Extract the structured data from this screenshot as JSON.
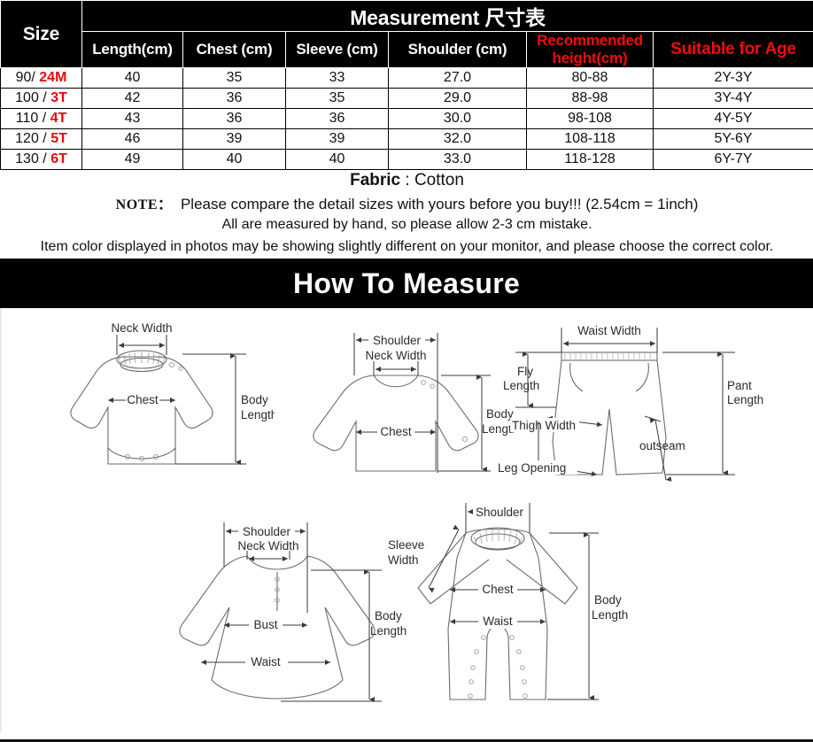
{
  "table": {
    "title": "Measurement 尺寸表",
    "size_header": "Size",
    "columns": [
      "Length(cm)",
      "Chest (cm)",
      "Sleeve (cm)",
      "Shoulder (cm)",
      "Recommended height(cm)",
      "Suitable for Age"
    ],
    "columns_split": {
      "recommended_l1": "Recommended",
      "recommended_l2": "height(cm)"
    },
    "rows": [
      {
        "size_num": "90/",
        "size_tag": "24M",
        "length": "40",
        "chest": "35",
        "sleeve": "33",
        "shoulder": "27.0",
        "height": "80-88",
        "age": "2Y-3Y"
      },
      {
        "size_num": "100 /",
        "size_tag": "3T",
        "length": "42",
        "chest": "36",
        "sleeve": "35",
        "shoulder": "29.0",
        "height": "88-98",
        "age": "3Y-4Y"
      },
      {
        "size_num": "110 /",
        "size_tag": "4T",
        "length": "43",
        "chest": "36",
        "sleeve": "36",
        "shoulder": "30.0",
        "height": "98-108",
        "age": "4Y-5Y"
      },
      {
        "size_num": "120 /",
        "size_tag": "5T",
        "length": "46",
        "chest": "39",
        "sleeve": "39",
        "shoulder": "32.0",
        "height": "108-118",
        "age": "5Y-6Y"
      },
      {
        "size_num": "130 /",
        "size_tag": "6T",
        "length": "49",
        "chest": "40",
        "sleeve": "40",
        "shoulder": "33.0",
        "height": "118-128",
        "age": "6Y-7Y"
      }
    ],
    "fabric_label": "Fabric",
    "fabric_value": " : Cotton",
    "note_label": "NOTE：",
    "note_text": "Please compare the detail sizes with yours before you buy!!! (2.54cm = 1inch)",
    "measure_note": "All are measured by hand, so please allow 2-3 cm mistake.",
    "color_note": "Item color displayed in photos may be showing slightly different on your monitor, and please choose the correct color."
  },
  "banner": {
    "title": "How To Measure"
  },
  "diagrams": {
    "bodysuit": {
      "neck_width": "Neck Width",
      "chest": "Chest",
      "body_l1": "Body",
      "body_l2": "Length"
    },
    "sweater": {
      "shoulder": "Shoulder",
      "neck_width": "Neck Width",
      "chest": "Chest",
      "body_l1": "Body",
      "body_l2": "Length"
    },
    "shorts": {
      "waist_width": "Waist Width",
      "fly_l1": "Fly",
      "fly_l2": "Length",
      "pant_l1": "Pant",
      "pant_l2": "Length",
      "thigh_width": "Thigh Width",
      "leg_opening": "Leg Opening",
      "outseam": "outseam"
    },
    "dress": {
      "shoulder": "Shoulder",
      "neck_width": "Neck Width",
      "bust": "Bust",
      "waist": "Waist",
      "body_l1": "Body",
      "body_l2": "Length"
    },
    "romper": {
      "shoulder": "Shoulder",
      "sleeve_l1": "Sleeve",
      "sleeve_l2": "Width",
      "chest": "Chest",
      "waist": "Waist",
      "body_l1": "Body",
      "body_l2": "Length"
    }
  },
  "colors": {
    "red": "#e8090a",
    "header_bg": "#000000",
    "line": "#6b6b6b"
  }
}
